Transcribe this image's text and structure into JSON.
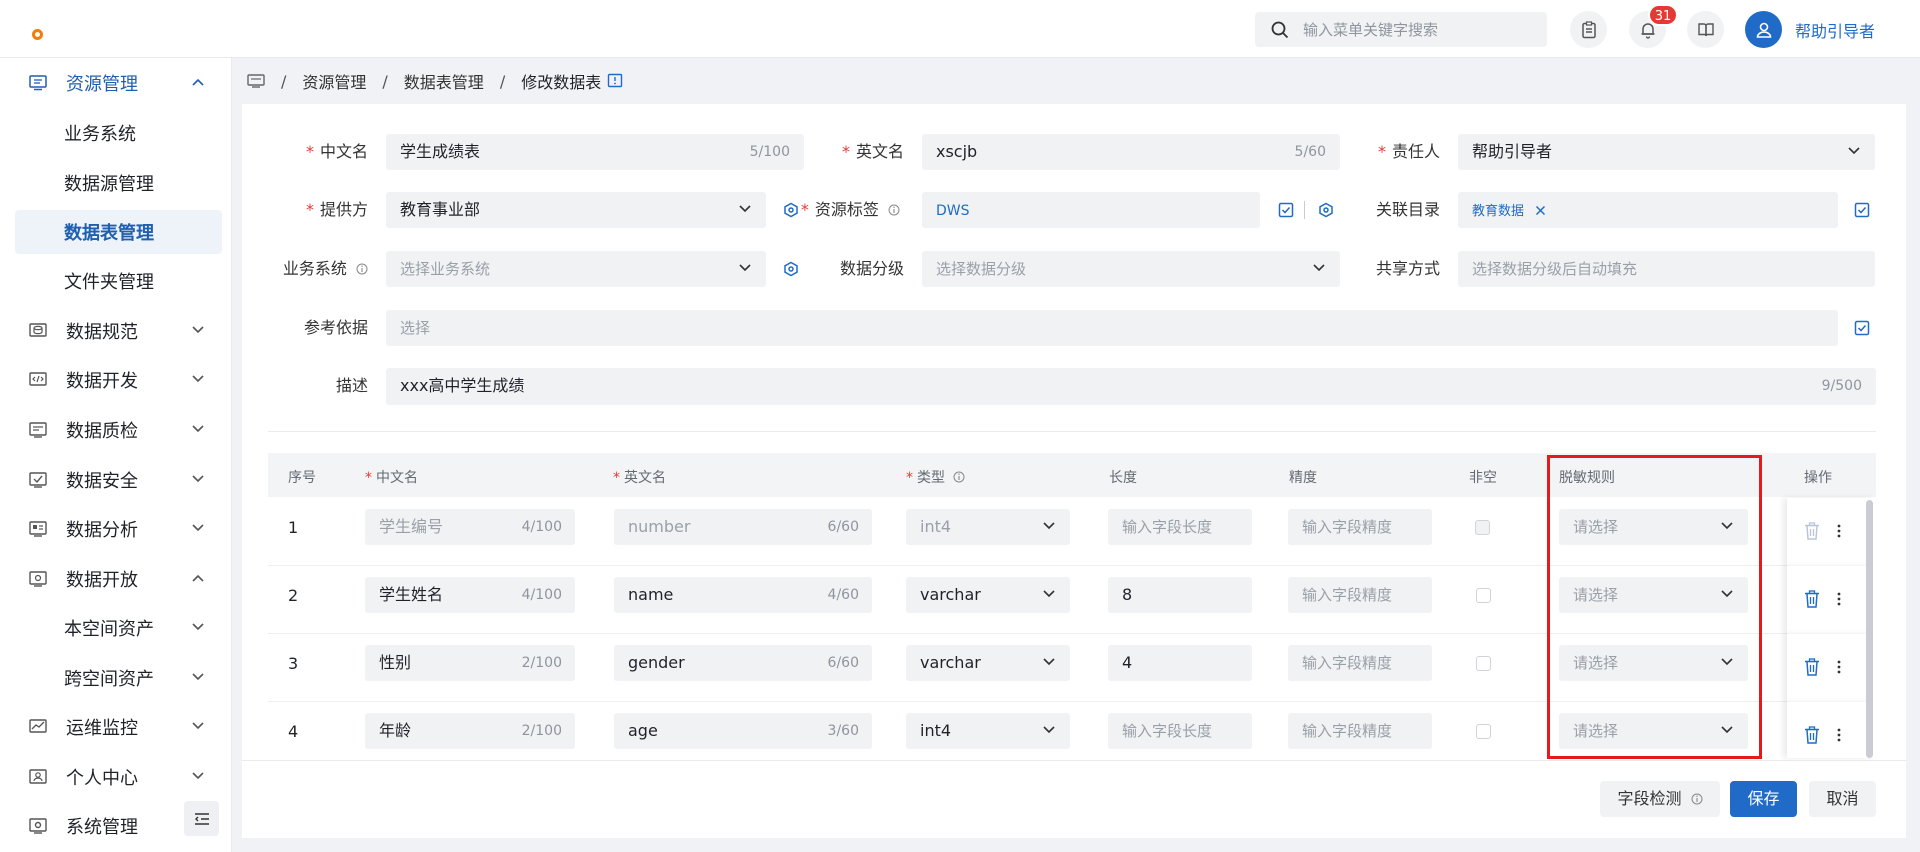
{
  "header": {
    "search_placeholder": "输入菜单关键字搜索",
    "notification_count": "31",
    "user_name": "帮助引导者"
  },
  "sidebar": {
    "items": [
      {
        "label": "资源管理",
        "icon": "monitor-icon",
        "state": "open"
      },
      {
        "label": "业务系统",
        "sub": true
      },
      {
        "label": "数据源管理",
        "sub": true
      },
      {
        "label": "数据表管理",
        "sub": true,
        "active": true
      },
      {
        "label": "文件夹管理",
        "sub": true
      },
      {
        "label": "数据规范",
        "icon": "database-icon"
      },
      {
        "label": "数据开发",
        "icon": "code-icon"
      },
      {
        "label": "数据质检",
        "icon": "inspect-icon"
      },
      {
        "label": "数据安全",
        "icon": "shield-check-icon"
      },
      {
        "label": "数据分析",
        "icon": "analysis-icon"
      },
      {
        "label": "数据开放",
        "icon": "open-icon",
        "state": "expanded"
      },
      {
        "label": "本空间资产",
        "sub": true,
        "chev": true
      },
      {
        "label": "跨空间资产",
        "sub": true,
        "chev": true
      },
      {
        "label": "运维监控",
        "icon": "chart-line-icon"
      },
      {
        "label": "个人中心",
        "icon": "user-card-icon"
      },
      {
        "label": "系统管理",
        "icon": "settings-box-icon"
      }
    ]
  },
  "breadcrumb": {
    "items": [
      "资源管理",
      "数据表管理",
      "修改数据表"
    ],
    "separator": "/"
  },
  "form": {
    "cn_name": {
      "label": "中文名",
      "value": "学生成绩表",
      "count": "5/100"
    },
    "en_name": {
      "label": "英文名",
      "value": "xscjb",
      "count": "5/60"
    },
    "owner": {
      "label": "责任人",
      "value": "帮助引导者"
    },
    "provider": {
      "label": "提供方",
      "value": "教育事业部"
    },
    "resource_tag": {
      "label": "资源标签",
      "value": "DWS"
    },
    "catalog": {
      "label": "关联目录",
      "tag": "教育数据"
    },
    "biz_system": {
      "label": "业务系统",
      "placeholder": "选择业务系统"
    },
    "data_level": {
      "label": "数据分级",
      "placeholder": "选择数据分级"
    },
    "share_mode": {
      "label": "共享方式",
      "placeholder": "选择数据分级后自动填充"
    },
    "reference": {
      "label": "参考依据",
      "placeholder": "选择"
    },
    "description": {
      "label": "描述",
      "value": "xxx高中学生成绩",
      "count": "9/500"
    }
  },
  "table": {
    "headers": {
      "idx": "序号",
      "cn": "中文名",
      "en": "英文名",
      "type": "类型",
      "length": "长度",
      "precision": "精度",
      "notnull": "非空",
      "mask": "脱敏规则",
      "ops": "操作"
    },
    "length_placeholder": "输入字段长度",
    "precision_placeholder": "输入字段精度",
    "mask_placeholder": "请选择",
    "rows": [
      {
        "idx": "1",
        "cn": "学生编号",
        "cn_count": "4/100",
        "en": "number",
        "en_count": "6/60",
        "type": "int4",
        "length": "",
        "disabled": true
      },
      {
        "idx": "2",
        "cn": "学生姓名",
        "cn_count": "4/100",
        "en": "name",
        "en_count": "4/60",
        "type": "varchar",
        "length": "8"
      },
      {
        "idx": "3",
        "cn": "性别",
        "cn_count": "2/100",
        "en": "gender",
        "en_count": "6/60",
        "type": "varchar",
        "length": "4"
      },
      {
        "idx": "4",
        "cn": "年龄",
        "cn_count": "2/100",
        "en": "age",
        "en_count": "3/60",
        "type": "int4",
        "length": ""
      }
    ]
  },
  "footer": {
    "check_label": "字段检测",
    "save_label": "保存",
    "cancel_label": "取消"
  },
  "colors": {
    "primary": "#1f6bc7",
    "highlight": "#e51b1b",
    "badge": "#e53935"
  }
}
